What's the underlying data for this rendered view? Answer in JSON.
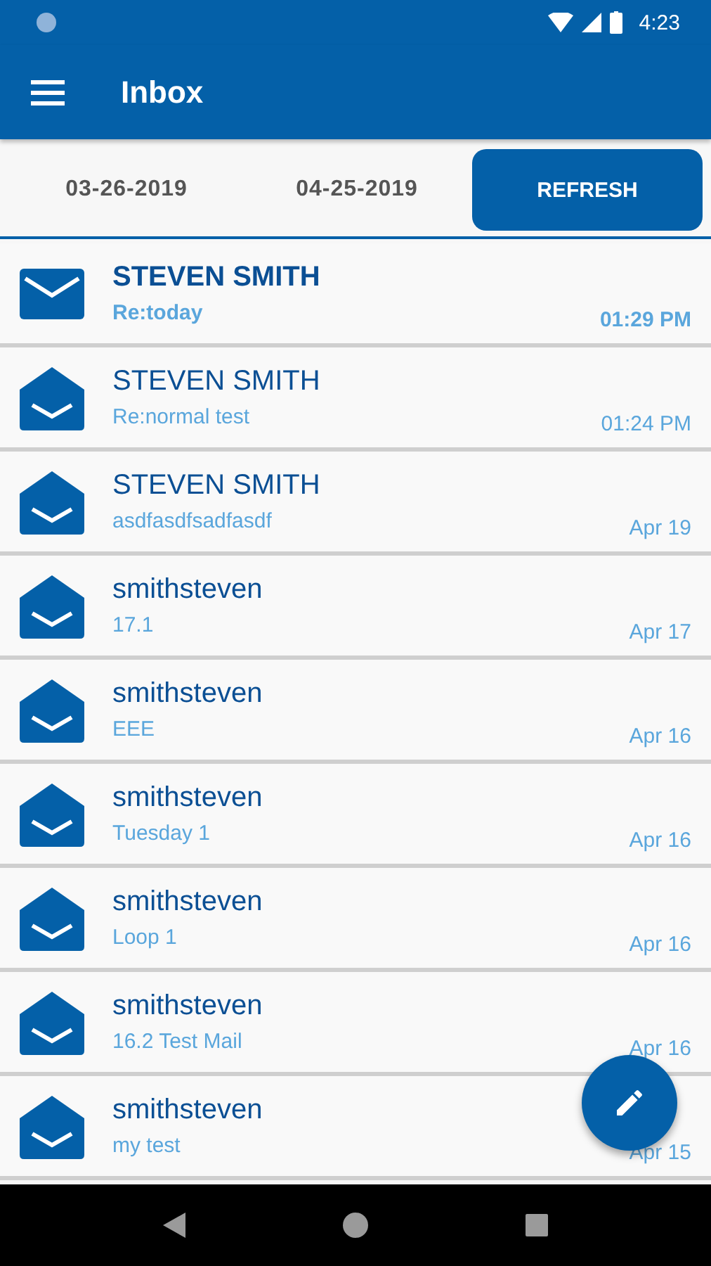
{
  "status_bar": {
    "time": "4:23"
  },
  "app_bar": {
    "title": "Inbox"
  },
  "filter": {
    "from_date": "03-26-2019",
    "to_date": "04-25-2019",
    "button": "REFRESH"
  },
  "messages": [
    {
      "sender": "STEVEN SMITH",
      "subject": "Re:today",
      "time": "01:29 PM",
      "read": false
    },
    {
      "sender": "STEVEN SMITH",
      "subject": "Re:normal test",
      "time": "01:24 PM",
      "read": true
    },
    {
      "sender": "STEVEN SMITH",
      "subject": "asdfasdfsadfasdf",
      "time": "Apr 19",
      "read": true
    },
    {
      "sender": "smithsteven",
      "subject": "17.1",
      "time": "Apr 17",
      "read": true
    },
    {
      "sender": "smithsteven",
      "subject": "EEE",
      "time": "Apr 16",
      "read": true
    },
    {
      "sender": "smithsteven",
      "subject": "Tuesday 1",
      "time": "Apr 16",
      "read": true
    },
    {
      "sender": "smithsteven",
      "subject": "Loop 1",
      "time": "Apr 16",
      "read": true
    },
    {
      "sender": "smithsteven",
      "subject": "16.2 Test Mail",
      "time": "Apr 16",
      "read": true
    },
    {
      "sender": "smithsteven",
      "subject": "my test",
      "time": "Apr 15",
      "read": true
    }
  ]
}
